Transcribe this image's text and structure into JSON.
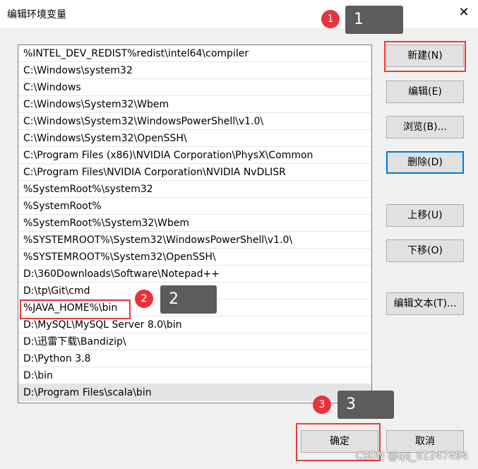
{
  "window": {
    "title": "编辑环境变量",
    "close_symbol": "✕"
  },
  "paths": [
    "%INTEL_DEV_REDIST%redist\\intel64\\compiler",
    "C:\\Windows\\system32",
    "C:\\Windows",
    "C:\\Windows\\System32\\Wbem",
    "C:\\Windows\\System32\\WindowsPowerShell\\v1.0\\",
    "C:\\Windows\\System32\\OpenSSH\\",
    "C:\\Program Files (x86)\\NVIDIA Corporation\\PhysX\\Common",
    "C:\\Program Files\\NVIDIA Corporation\\NVIDIA NvDLISR",
    "%SystemRoot%\\system32",
    "%SystemRoot%",
    "%SystemRoot%\\System32\\Wbem",
    "%SYSTEMROOT%\\System32\\WindowsPowerShell\\v1.0\\",
    "%SYSTEMROOT%\\System32\\OpenSSH\\",
    "D:\\360Downloads\\Software\\Notepad++",
    "D:\\tp\\Git\\cmd",
    "%JAVA_HOME%\\bin",
    "D:\\MySQL\\MySQL Server 8.0\\bin",
    "D:\\迅雷下载\\Bandizip\\",
    "D:\\Python 3.8",
    "D:\\bin",
    "D:\\Program Files\\scala\\bin"
  ],
  "buttons": {
    "new": "新建(N)",
    "edit": "编辑(E)",
    "browse": "浏览(B)...",
    "delete": "删除(D)",
    "move_up": "上移(U)",
    "move_down": "下移(O)",
    "edit_text": "编辑文本(T)...",
    "ok": "确定",
    "cancel": "取消"
  },
  "annotations": {
    "marker1": "1",
    "tag1": "1",
    "marker2": "2",
    "tag2": "2",
    "marker3": "3",
    "tag3": "3",
    "accent_color": "#e83c3c"
  },
  "watermark": "CSDN @qq_61247494"
}
